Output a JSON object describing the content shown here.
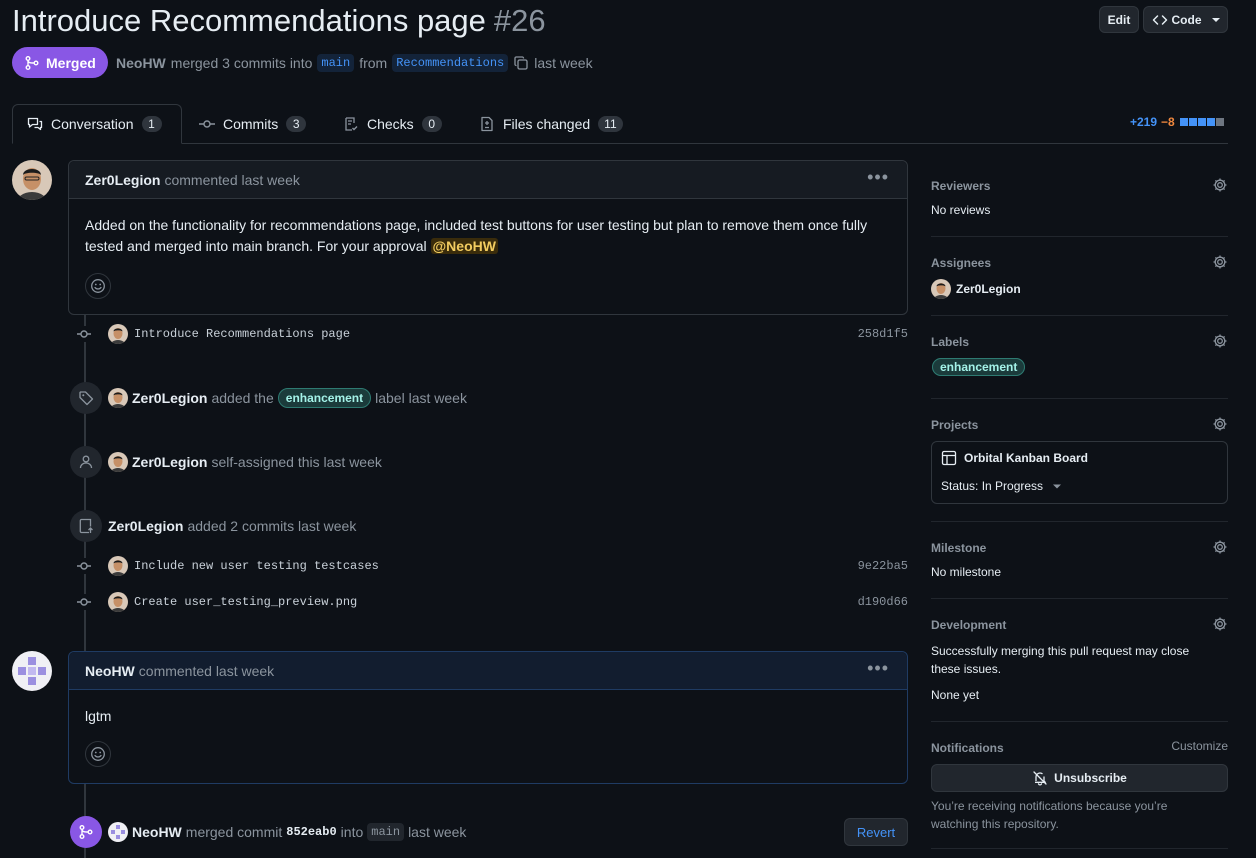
{
  "header": {
    "title": "Introduce Recommendations page",
    "number": "#26",
    "edit_label": "Edit",
    "code_label": "Code"
  },
  "status": {
    "state": "Merged",
    "author": "NeoHW",
    "text_merged": "merged 3 commits into",
    "base_branch": "main",
    "text_from": "from",
    "head_branch": "Recommendations",
    "time": "last week"
  },
  "tabs": [
    {
      "label": "Conversation",
      "count": "1",
      "icon": "comment-discussion-icon"
    },
    {
      "label": "Commits",
      "count": "3",
      "icon": "commit-icon"
    },
    {
      "label": "Checks",
      "count": "0",
      "icon": "checklist-icon"
    },
    {
      "label": "Files changed",
      "count": "11",
      "icon": "file-diff-icon"
    }
  ],
  "diffstat": {
    "additions": "+219",
    "deletions": "−8",
    "colors": [
      "#4493f8",
      "#4493f8",
      "#4493f8",
      "#4493f8",
      "#6e7681"
    ]
  },
  "timeline": {
    "comment1": {
      "author": "Zer0Legion",
      "meta": "commented last week",
      "body": "Added on the functionality for recommendations page, included test buttons for user testing but plan to remove them once fully tested and merged into main branch. For your approval",
      "mention": "@NeoHW"
    },
    "commit1": {
      "message": "Introduce Recommendations page",
      "sha": "258d1f5"
    },
    "label_event": {
      "actor": "Zer0Legion",
      "pre": "added the",
      "label": "enhancement",
      "post": "label last week"
    },
    "assign_event": {
      "actor": "Zer0Legion",
      "text": "self-assigned this last week"
    },
    "commits_event": {
      "actor": "Zer0Legion",
      "text": "added 2 commits last week"
    },
    "commit2": {
      "message": "Include new user testing testcases",
      "sha": "9e22ba5"
    },
    "commit3": {
      "message": "Create user_testing_preview.png",
      "sha": "d190d66"
    },
    "comment2": {
      "author": "NeoHW",
      "meta": "commented last week",
      "body": "lgtm"
    },
    "merge_event": {
      "actor": "NeoHW",
      "pre": "merged commit",
      "sha": "852eab0",
      "mid": "into",
      "branch": "main",
      "post": "last week",
      "revert_label": "Revert"
    }
  },
  "sidebar": {
    "reviewers": {
      "title": "Reviewers",
      "value": "No reviews"
    },
    "assignees": {
      "title": "Assignees",
      "value": "Zer0Legion"
    },
    "labels": {
      "title": "Labels",
      "value": "enhancement"
    },
    "projects": {
      "title": "Projects",
      "board": "Orbital Kanban Board",
      "status": "Status: In Progress"
    },
    "milestone": {
      "title": "Milestone",
      "value": "No milestone"
    },
    "development": {
      "title": "Development",
      "text": "Successfully merging this pull request may close these issues.",
      "none": "None yet"
    },
    "notifications": {
      "title": "Notifications",
      "customize": "Customize",
      "button": "Unsubscribe",
      "note": "You’re receiving notifications because you’re watching this repository."
    }
  }
}
